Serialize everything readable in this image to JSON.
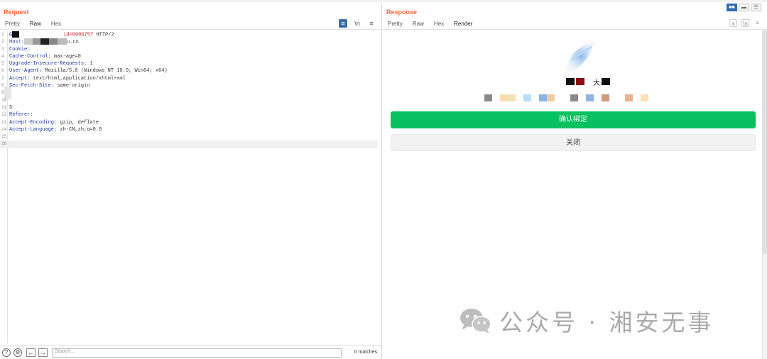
{
  "request": {
    "title": "Request",
    "tabs": [
      {
        "label": "Pretty",
        "active": false
      },
      {
        "label": "Raw",
        "active": true
      },
      {
        "label": "Hex",
        "active": false
      }
    ],
    "toolbar_icons": [
      "wrap-icon",
      "newline-icon",
      "menu-icon"
    ],
    "toolbar_labels": {
      "wrap": "≡",
      "newline": "\\n",
      "menu": "≡"
    },
    "lines": [
      {
        "n": "1",
        "key": "G",
        "value": "",
        "tail_red": "id=0000757",
        "tail": " HTTP/2"
      },
      {
        "n": "2",
        "key": "Host:",
        "value": "",
        "tail_red": "",
        "tail": "u.cn"
      },
      {
        "n": "3",
        "key": "Cookie:",
        "value": "",
        "tail_red": "",
        "tail": ""
      },
      {
        "n": "4",
        "key": "Cache-Control:",
        "value": " max-age=0",
        "tail_red": "",
        "tail": ""
      },
      {
        "n": "5",
        "key": "Upgrade-Insecure-Requests:",
        "value": " 1",
        "tail_red": "",
        "tail": ""
      },
      {
        "n": "6",
        "key": "User-Agent:",
        "value": " Mozilla/5.0 (Windows NT 10.0; Win64; x64)",
        "tail_red": "",
        "tail": ""
      },
      {
        "n": "7",
        "key": "Accept:",
        "value": " text/html,application/xhtml+xml",
        "tail_red": "",
        "tail": ""
      },
      {
        "n": "8",
        "key": "Sec-Fetch-Site:",
        "value": " same-origin",
        "tail_red": "",
        "tail": ""
      },
      {
        "n": "9",
        "key": "",
        "value": "",
        "tail_red": "",
        "tail": ""
      },
      {
        "n": "10",
        "key": "",
        "value": "",
        "tail_red": "",
        "tail": ""
      },
      {
        "n": "11",
        "key": "S",
        "value": "",
        "tail_red": "",
        "tail": ""
      },
      {
        "n": "12",
        "key": "Referer:",
        "value": "",
        "tail_red": "",
        "tail": ""
      },
      {
        "n": "13",
        "key": "Accept-Encoding:",
        "value": " gzip, deflate",
        "tail_red": "",
        "tail": ""
      },
      {
        "n": "14",
        "key": "Accept-Language:",
        "value": " zh-CN,zh;q=0.9",
        "tail_red": "",
        "tail": ""
      },
      {
        "n": "15",
        "key": "",
        "value": "",
        "tail_red": "",
        "tail": ""
      },
      {
        "n": "16",
        "key": "",
        "value": "",
        "tail_red": "",
        "tail": ""
      }
    ],
    "footer": {
      "search_placeholder": "Search...",
      "matches": "0 matches",
      "help_glyph": "?",
      "settings_glyph": "⚙",
      "prev_glyph": "←",
      "next_glyph": "→"
    }
  },
  "response": {
    "title": "Response",
    "tabs": [
      {
        "label": "Pretty",
        "active": false
      },
      {
        "label": "Raw",
        "active": false
      },
      {
        "label": "Hex",
        "active": false
      },
      {
        "label": "Render",
        "active": true
      }
    ],
    "layout_buttons": [
      "■■",
      "▬",
      "☰"
    ],
    "render": {
      "name_char": "大",
      "confirm_button": "确认绑定",
      "close_button": "关闭"
    },
    "colors": {
      "confirm_green": "#07c160",
      "accent_orange": "#ff6633",
      "layout_blue": "#2f6bb5"
    }
  },
  "watermark": {
    "text": "公众号 · 湘安无事"
  }
}
